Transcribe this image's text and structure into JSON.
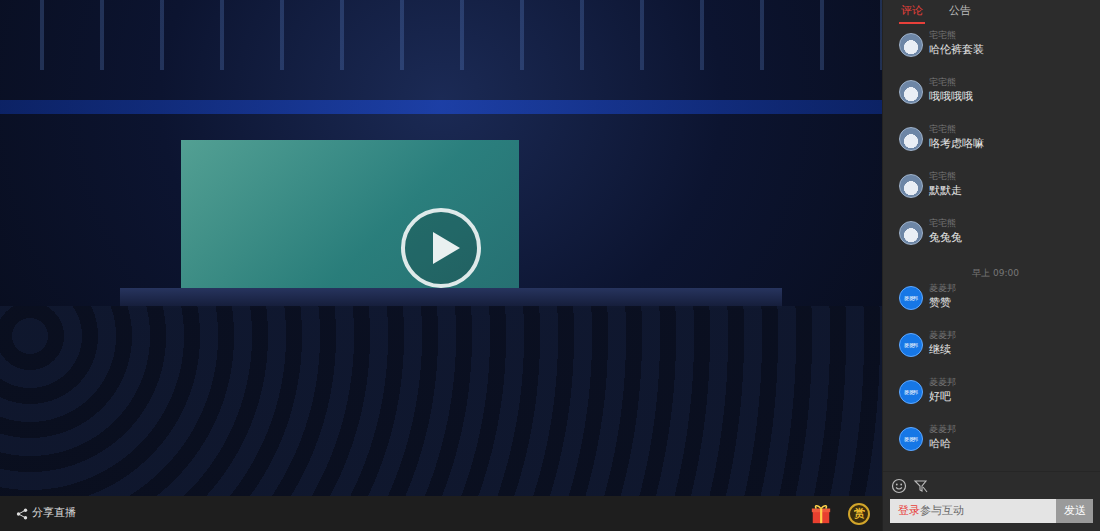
{
  "bottom_bar": {
    "share_label": "分享直播",
    "reward_label": "赏"
  },
  "tabs": [
    {
      "label": "评论",
      "selected": true
    },
    {
      "label": "公告",
      "selected": false
    }
  ],
  "comments": [
    {
      "kind": "message",
      "user": "宅宅熊",
      "text": "哈伦裤套装",
      "avatar_kind": "photo"
    },
    {
      "kind": "message",
      "user": "宅宅熊",
      "text": "哦哦哦哦",
      "avatar_kind": "photo"
    },
    {
      "kind": "message",
      "user": "宅宅熊",
      "text": "咯考虑咯嘛",
      "avatar_kind": "photo"
    },
    {
      "kind": "message",
      "user": "宅宅熊",
      "text": "默默走",
      "avatar_kind": "photo"
    },
    {
      "kind": "message",
      "user": "宅宅熊",
      "text": "兔兔兔",
      "avatar_kind": "photo"
    },
    {
      "kind": "time",
      "text": "早上 09:00"
    },
    {
      "kind": "message",
      "user": "菱菱邦",
      "text": "赞赞",
      "avatar_kind": "badge",
      "avatar_label": "菱菱邦"
    },
    {
      "kind": "message",
      "user": "菱菱邦",
      "text": "继续",
      "avatar_kind": "badge",
      "avatar_label": "菱菱邦"
    },
    {
      "kind": "message",
      "user": "菱菱邦",
      "text": "好吧",
      "avatar_kind": "badge",
      "avatar_label": "菱菱邦"
    },
    {
      "kind": "message",
      "user": "菱菱邦",
      "text": "哈哈",
      "avatar_kind": "badge",
      "avatar_label": "菱菱邦"
    }
  ],
  "composer": {
    "login_link": "登录",
    "placeholder": "参与互动",
    "send": "发送"
  }
}
